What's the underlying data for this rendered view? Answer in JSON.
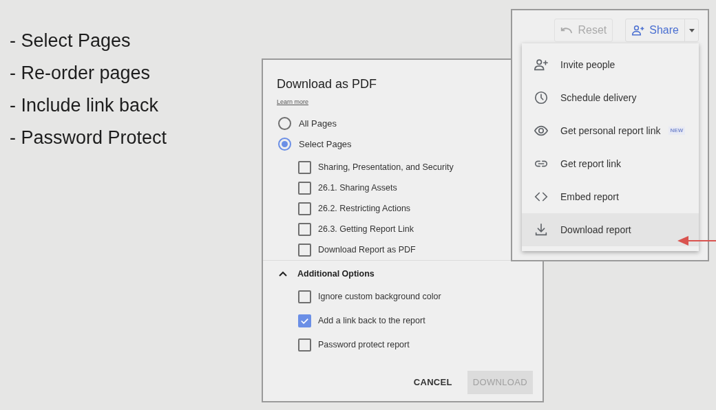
{
  "bullets": [
    "- Select Pages",
    "- Re-order pages",
    "- Include link back",
    "- Password Protect"
  ],
  "dialog": {
    "title": "Download as PDF",
    "link": "Learn more",
    "page_options": [
      {
        "label": "All Pages",
        "selected": false
      },
      {
        "label": "Select Pages",
        "selected": true
      }
    ],
    "pages": [
      {
        "label": "Sharing, Presentation, and Security",
        "checked": false
      },
      {
        "label": "26.1. Sharing Assets",
        "checked": false
      },
      {
        "label": "26.2. Restricting Actions",
        "checked": false
      },
      {
        "label": "26.3. Getting Report Link",
        "checked": false
      },
      {
        "label": "Download Report as PDF",
        "checked": false
      }
    ],
    "section": {
      "title": "Additional Options",
      "expanded": true
    },
    "options": [
      {
        "label": "Ignore custom background color",
        "checked": false
      },
      {
        "label": "Add a link back to the report",
        "checked": true
      },
      {
        "label": "Password protect report",
        "checked": false
      }
    ],
    "buttons": [
      {
        "label": "CANCEL",
        "disabled": false
      },
      {
        "label": "DOWNLOAD",
        "disabled": true
      }
    ]
  },
  "toolbar": {
    "reset": {
      "label": "Reset",
      "disabled": true
    },
    "share": {
      "label": "Share"
    }
  },
  "menu": [
    {
      "kind": "invite",
      "label": "Invite people",
      "selected": false
    },
    {
      "kind": "schedule",
      "label": "Schedule delivery",
      "selected": false
    },
    {
      "kind": "personal",
      "label": "Get personal report link",
      "badge": "NEW",
      "selected": false
    },
    {
      "kind": "link",
      "label": "Get report link",
      "selected": false
    },
    {
      "kind": "embed",
      "label": "Embed report",
      "selected": false
    },
    {
      "kind": "download",
      "label": "Download report",
      "selected": true
    }
  ]
}
